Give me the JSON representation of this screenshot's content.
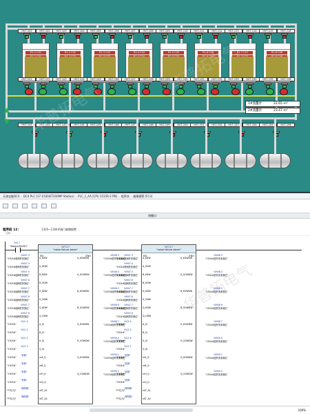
{
  "hmi": {
    "tanks": [
      {
        "label": "R1-1 C01"
      },
      {
        "label": "R1-2 C02"
      },
      {
        "label": "R1-3 C03"
      },
      {
        "label": "R1-4 C04"
      },
      {
        "label": "R1-5 C05"
      },
      {
        "label": "R1-6 C06"
      },
      {
        "label": "R1-7 C07"
      },
      {
        "label": "R1-8 C08"
      }
    ],
    "top_tags": [
      "HV7-101",
      "HV7-102",
      "HV7-103",
      "HV7-104",
      "HV7-105",
      "HV7-106",
      "HV7-107",
      "HV7-108",
      "HV7-109",
      "HV7-110",
      "HV7-111",
      "HV7-112",
      "HV7-113",
      "HV7-114",
      "HV7-115",
      "HV7-116"
    ],
    "mid_tags": [
      "HV7-121",
      "HV7-122",
      "HV7-123",
      "HV7-124",
      "HV7-125",
      "HV7-126",
      "HV7-127",
      "HV7-128",
      "HV7-129",
      "HV7-130",
      "HV7-131",
      "HV7-132",
      "HV7-133",
      "HV7-134",
      "HV7-135",
      "HV7-136"
    ],
    "bottom_tags": [
      "HV7-141",
      "HV7-142",
      "HV7-143",
      "HV7-144",
      "HV7-145",
      "HV7-146",
      "HV7-147",
      "HV7-148",
      "HV7-149",
      "HV7-150",
      "HV7-151",
      "HV7-152",
      "HV7-153",
      "HV7-154",
      "HV7-155",
      "HV7-156"
    ],
    "flow1_label": "1#流量计",
    "flow1_value": "22.65 m³",
    "flow2_label": "2#流量计",
    "flow2_value": "23.47 m³",
    "colors": {
      "bg": "#2a8a86",
      "pipe": "#d9d9d9",
      "bus": "#e7dd2a",
      "valve_open": "#3ab54a",
      "valve_closed": "#c62828"
    }
  },
  "tia": {
    "breadcrumb": [
      "天津宝能DC4",
      "DC4 PLC [S7-1500/ET200MP Station]",
      "PLC_1_AA [CPU 1515R-2 PN]",
      "程序块",
      "故障报警 [FC3]"
    ],
    "block_label": "块接口",
    "network_title": "程序段 12：",
    "network_comment": "1305~1304#阀门故障报警",
    "comment_label": "注释",
    "left_contact": "%I0.1",
    "left_contact_name": "\"Always(FALSE)\"",
    "fb1": {
      "db": "%FC17",
      "name": "\"valve failure alarm\"",
      "en": "EN",
      "eno": "ENO"
    },
    "fb2": {
      "db": "%FC17",
      "name": "\"valve failure alarm\"",
      "en": "EN",
      "eno": "ENO"
    },
    "fb1_inputs": [
      {
        "addr": "%M47.3",
        "name": "\"1303#进阀开关到位\"",
        "pin": "A_KDW"
      },
      {
        "addr": "%M47.4",
        "name": "\"1303#进阀关关到位\"",
        "pin": "A_GDW"
      },
      {
        "addr": "%M47.5",
        "name": "\"1303#回阀开关到位\"",
        "pin": "B_KDW"
      },
      {
        "addr": "%M47.6",
        "name": "\"1303#回阀关关到位\"",
        "pin": "B_GDW"
      },
      {
        "addr": "%M47.7",
        "name": "\"1303#回阀开关到位\"",
        "pin": "H_KDW"
      },
      {
        "addr": "%M47.8",
        "name": "\"1303#回阀关关到位\"",
        "pin": "H_GDW"
      },
      {
        "addr": "%M47.7",
        "name": "\"1303#回阀开关到位\"",
        "pin": "Q_KDW"
      },
      {
        "addr": "%M47.8",
        "name": "\"1303#回阀关关到位\"",
        "pin": "Q_GDW"
      },
      {
        "addr": "%Q1.0",
        "name": "\"1303#\"",
        "pin": "A_SJ"
      },
      {
        "addr": "%Q1.1",
        "name": "\"1303#\"",
        "pin": "B_SJ"
      },
      {
        "addr": "%Q1.2",
        "name": "\"1303#\"",
        "pin": "H_SJ"
      },
      {
        "addr": "%Q1.3",
        "name": "\"1303#\"",
        "pin": "Q_SJ"
      },
      {
        "addr": "\"安置\"",
        "name": "\"1303#\"",
        "pin": "xrA_Q"
      },
      {
        "addr": "\"安置\"",
        "name": "\"1303#\"",
        "pin": "xrB_Q"
      },
      {
        "addr": "\"安置\"",
        "name": "\"1303#\"",
        "pin": "xrH_Q"
      },
      {
        "addr": "\"安置\"",
        "name": "\"1303#\"",
        "pin": "xrQ_Q"
      },
      {
        "addr": "\"故障数\"",
        "name": "\"FTC[3]\"",
        "pin": "xST_A1"
      },
      {
        "addr": "\"故障数\"",
        "name": "\"FTC[3]\"",
        "pin": "xST_A2"
      }
    ],
    "fb1_outputs": [
      {
        "addr": "%M48.3",
        "name": "\"1303#进开关未到位\"",
        "pin": "A_KGWDW"
      },
      {
        "addr": "%M48.4",
        "name": "\"1303#进关关未到位\"",
        "pin": "A_GGWDW"
      },
      {
        "addr": "%M48.5",
        "name": "\"1303#回开关未到位\"",
        "pin": "B_KGWDW"
      },
      {
        "addr": "%M48.6",
        "name": "\"1303#回关关未到位\"",
        "pin": "B_GGWDW"
      },
      {
        "addr": "%M48.7",
        "name": "\"1303#回开关未到位\"",
        "pin": "H_KGWDW"
      },
      {
        "addr": "%M49.0",
        "name": "\"1303#回关关未到位\"",
        "pin": "H_GGWDW"
      },
      {
        "addr": "%M49.1",
        "name": "\"1303#回开关未到位\"",
        "pin": "Q_KGWDW"
      },
      {
        "addr": "%M49.2",
        "name": "\"1303#回关关未到位\"",
        "pin": "Q_GGWDW"
      }
    ],
    "fb2_inputs": [
      {
        "addr": "%M47.3",
        "name": "\"1304#进阀开关到位\"",
        "pin": "A_KDW"
      },
      {
        "addr": "%M47.4",
        "name": "\"1304#进阀关关到位\"",
        "pin": "A_GDW"
      },
      {
        "addr": "%M47.5",
        "name": "\"1304#回阀开关到位\"",
        "pin": "B_KDW"
      },
      {
        "addr": "%M47.6",
        "name": "\"1304#回阀关关到位\"",
        "pin": "B_GDW"
      },
      {
        "addr": "%M47.7",
        "name": "\"1304#回阀开关到位\"",
        "pin": "H_KDW"
      },
      {
        "addr": "%M47.8",
        "name": "\"1304#回阀关关到位\"",
        "pin": "H_GDW"
      },
      {
        "addr": "%M47.7",
        "name": "\"1304#回阀开关到位\"",
        "pin": "Q_KDW"
      },
      {
        "addr": "%M47.8",
        "name": "\"1304#回阀关关到位\"",
        "pin": "Q_GDW"
      },
      {
        "addr": "%Q1.4",
        "name": "\"1304#\"",
        "pin": "A_SJ"
      },
      {
        "addr": "%Q1.5",
        "name": "\"1304#\"",
        "pin": "B_SJ"
      },
      {
        "addr": "%Q1.6",
        "name": "\"1304#\"",
        "pin": "H_SJ"
      },
      {
        "addr": "%Q1.7",
        "name": "\"1304#\"",
        "pin": "Q_SJ"
      },
      {
        "addr": "\"安置\"",
        "name": "\"1304#\"",
        "pin": "xrA_Q"
      },
      {
        "addr": "\"安置\"",
        "name": "\"1304#\"",
        "pin": "xrB_Q"
      },
      {
        "addr": "\"安置\"",
        "name": "\"1304#\"",
        "pin": "xrH_Q"
      },
      {
        "addr": "\"安置\"",
        "name": "\"1304#\"",
        "pin": "xrQ_Q"
      },
      {
        "addr": "\"故障数\"",
        "name": "\"FTC[3]\"",
        "pin": "xST_A1"
      },
      {
        "addr": "\"故障数\"",
        "name": "\"FTC[3]\"",
        "pin": "xST_A2"
      }
    ],
    "fb2_outputs": [
      {
        "addr": "%M48.3",
        "name": "\"1304#进开关未到位\"",
        "pin": "A_KGWDW"
      },
      {
        "addr": "%M48.4",
        "name": "\"1304#进关关未到位\"",
        "pin": "A_GGWDW"
      },
      {
        "addr": "%M48.5",
        "name": "\"1304#回开关未到位\"",
        "pin": "B_KGWDW"
      },
      {
        "addr": "%M48.6",
        "name": "\"1304#回关关未到位\"",
        "pin": "B_GGWDW"
      },
      {
        "addr": "%M48.7",
        "name": "\"1304#回开关未到位\"",
        "pin": "H_KGWDW"
      },
      {
        "addr": "%M49.0",
        "name": "\"1304#回关关未到位\"",
        "pin": "H_GGWDW"
      },
      {
        "addr": "%M49.1",
        "name": "\"1304#回开关未到位\"",
        "pin": "Q_KGWDW"
      },
      {
        "addr": "%M49.2",
        "name": "\"1304#回关关未到位\"",
        "pin": "Q_GGWDW"
      }
    ],
    "zoom": "100%"
  },
  "watermark": "华普拓电气"
}
